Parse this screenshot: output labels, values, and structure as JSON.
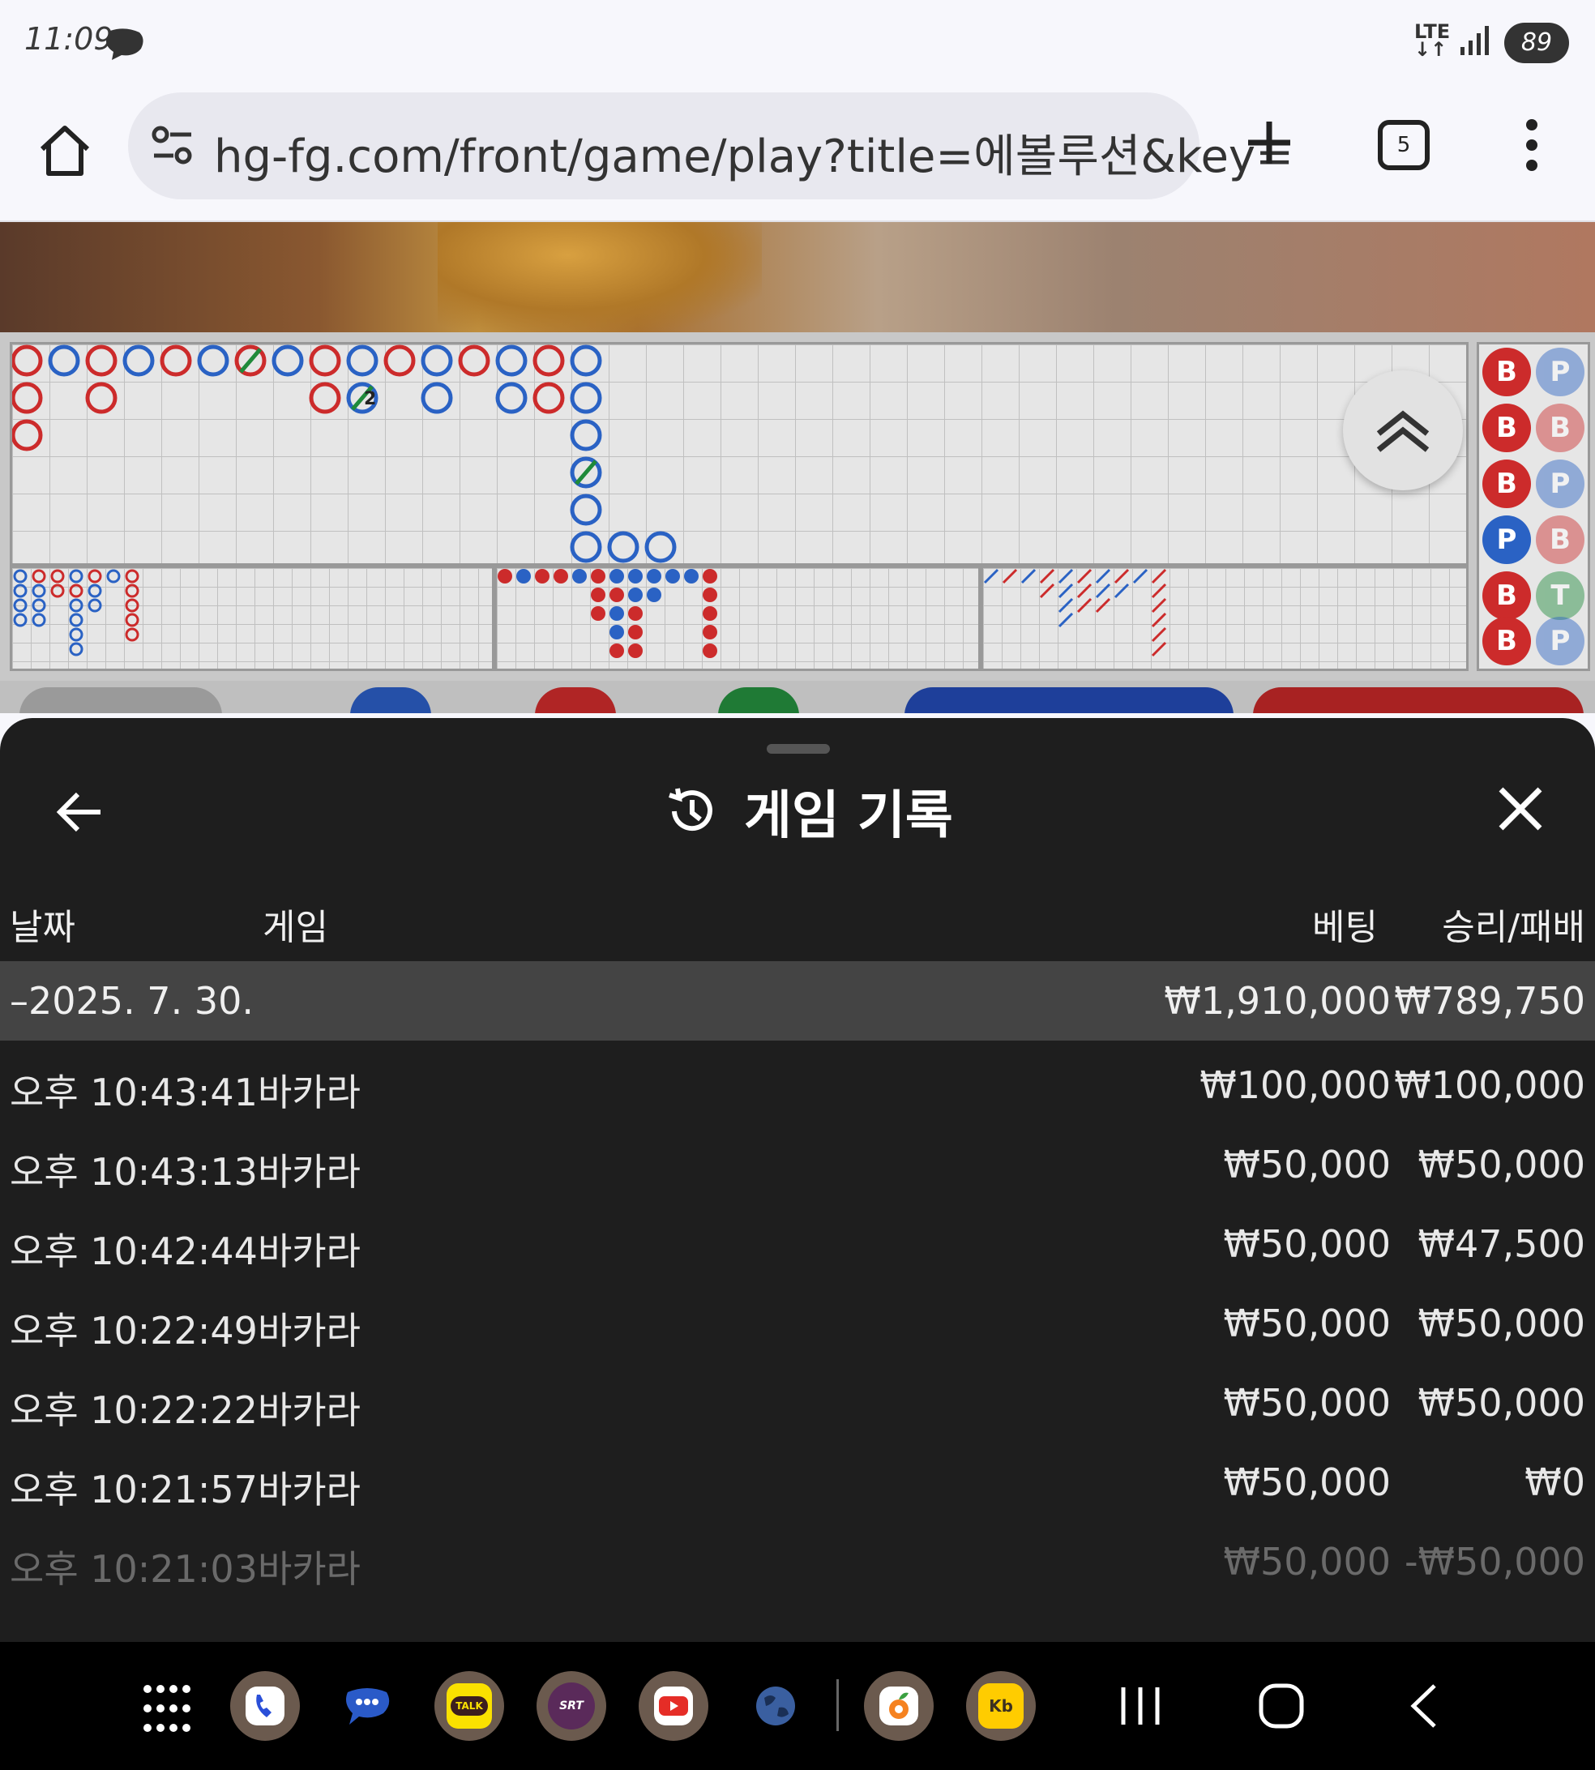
{
  "status": {
    "time": "11:09",
    "network": "LTE",
    "battery": "89"
  },
  "browser": {
    "url": "hg-fg.com/front/game/play?title=에볼루션&key=",
    "tab_count": "5"
  },
  "roadmap": {
    "side_chips": [
      {
        "left": "B",
        "right": "P"
      },
      {
        "left": "B",
        "right": "B"
      },
      {
        "left": "B",
        "right": "P"
      },
      {
        "left": "P",
        "right": "B"
      },
      {
        "left": "B",
        "right": "T"
      },
      {
        "left": "B",
        "right": "P"
      }
    ],
    "tie_marker": "2",
    "colors": {
      "banker": "#cc2b2b",
      "player": "#2a62c4",
      "tie": "#1f8a3a"
    }
  },
  "sheet": {
    "title": "게임 기록",
    "columns": {
      "date": "날짜",
      "game": "게임",
      "bet": "베팅",
      "result": "승리/패배"
    },
    "date_group": {
      "date": "–2025. 7. 30.",
      "bet_total": "₩1,910,000",
      "result_total": "₩789,750"
    },
    "rows": [
      {
        "time": "오후 10:43:41",
        "game": "바카라",
        "bet": "₩100,000",
        "result": "₩100,000"
      },
      {
        "time": "오후 10:43:13",
        "game": "바카라",
        "bet": "₩50,000",
        "result": "₩50,000"
      },
      {
        "time": "오후 10:42:44",
        "game": "바카라",
        "bet": "₩50,000",
        "result": "₩47,500"
      },
      {
        "time": "오후 10:22:49",
        "game": "바카라",
        "bet": "₩50,000",
        "result": "₩50,000"
      },
      {
        "time": "오후 10:22:22",
        "game": "바카라",
        "bet": "₩50,000",
        "result": "₩50,000"
      },
      {
        "time": "오후 10:21:57",
        "game": "바카라",
        "bet": "₩50,000",
        "result": "₩0"
      },
      {
        "time": "오후 10:21:03",
        "game": "바카라",
        "bet": "₩50,000",
        "result": "-₩50,000"
      }
    ]
  },
  "navbar": {
    "apps": [
      "apps-grid-icon",
      "phone-icon",
      "messages-icon",
      "kakaotalk-icon",
      "srt-icon",
      "youtube-icon",
      "browser-icon",
      "fruit-app-icon",
      "kb-bank-icon"
    ],
    "kakao_label": "TALK",
    "srt_label": "SRT",
    "kb_label": "Kb"
  }
}
